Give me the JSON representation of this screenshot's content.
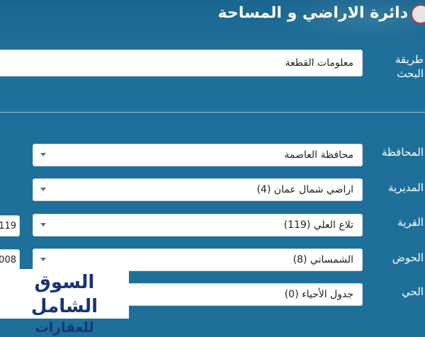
{
  "header": {
    "title": "دائرة الاراضي و المساحة"
  },
  "search_method": {
    "label": "طريقة البحث",
    "value": "معلومات القطعة"
  },
  "filters": {
    "governorate": {
      "label": "المحافظة",
      "value": "محافظة العاصمة"
    },
    "directorate": {
      "label": "المديرية",
      "value": "اراضي شمال عمان (4)"
    },
    "village": {
      "label": "القرية",
      "value": "تلاع العلي (119)",
      "code": "119"
    },
    "basin": {
      "label": "الحوض",
      "value": "الشمساني (8)",
      "code": "008"
    },
    "district": {
      "label": "الحي",
      "value": "جدول الأحياء (0)"
    }
  },
  "watermark": {
    "line1": "السوق الشامل",
    "line2": "للعقارات"
  },
  "colors": {
    "background": "#1e6f9a",
    "field": "#ffffff",
    "watermark_text": "#19337a"
  }
}
